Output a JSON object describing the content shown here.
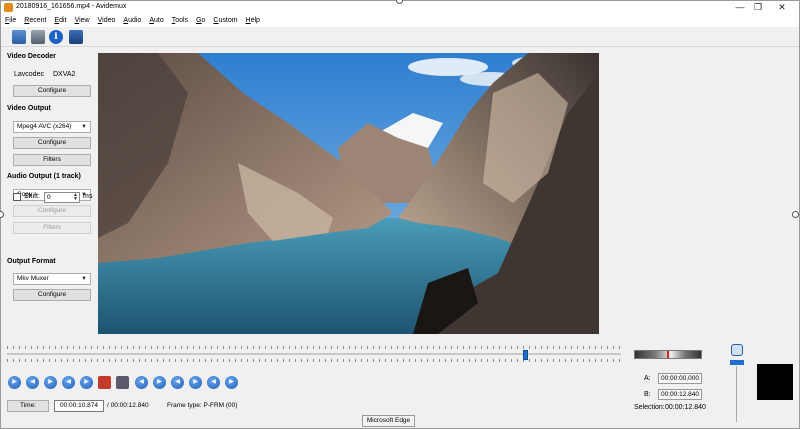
{
  "window": {
    "title": "20180916_161656.mp4 - Avidemux",
    "min_glyph": "—",
    "max_glyph": "❐",
    "close_glyph": "✕"
  },
  "menu": [
    "File",
    "Recent",
    "Edit",
    "View",
    "Video",
    "Audio",
    "Auto",
    "Tools",
    "Go",
    "Custom",
    "Help"
  ],
  "toolbar": {
    "icons": [
      "open-icon",
      "save-icon",
      "info-icon",
      "calculator-icon"
    ],
    "info_glyph": "i"
  },
  "video_decoder": {
    "title": "Video Decoder",
    "codec_label": "Lavcodec",
    "codec_value": "DXVA2",
    "configure": "Configure"
  },
  "video_output": {
    "title": "Video Output",
    "codec": "Mpeg4 AVC (x264)",
    "configure": "Configure",
    "filters": "Filters"
  },
  "audio_output": {
    "title": "Audio Output (1 track)",
    "codec": "Copy",
    "configure": "Configure",
    "filters": "Filters",
    "shift_label": "Shift:",
    "shift_value": "0",
    "shift_unit": "ms",
    "shift_checked": false
  },
  "output_format": {
    "title": "Output Format",
    "muxer": "Mkv Muxer",
    "configure": "Configure"
  },
  "playback": {
    "position_fraction": 0.846
  },
  "selection": {
    "a_label": "A:",
    "a_value": "00:00:00.000",
    "b_label": "B:",
    "b_value": "00:00:12.840",
    "selection_label": "Selection:",
    "selection_value": "00:00:12.840"
  },
  "status": {
    "time_button": "Time:",
    "current_time": "00:00:10.874",
    "duration": "/ 00:00:12.840",
    "frame_type": "Frame type:  P-FRM (00)"
  },
  "tooltip": "Microsoft Edge",
  "colors": {
    "accent": "#1f6fd1",
    "sky": "#4f97d6",
    "water": "#2f7390"
  }
}
